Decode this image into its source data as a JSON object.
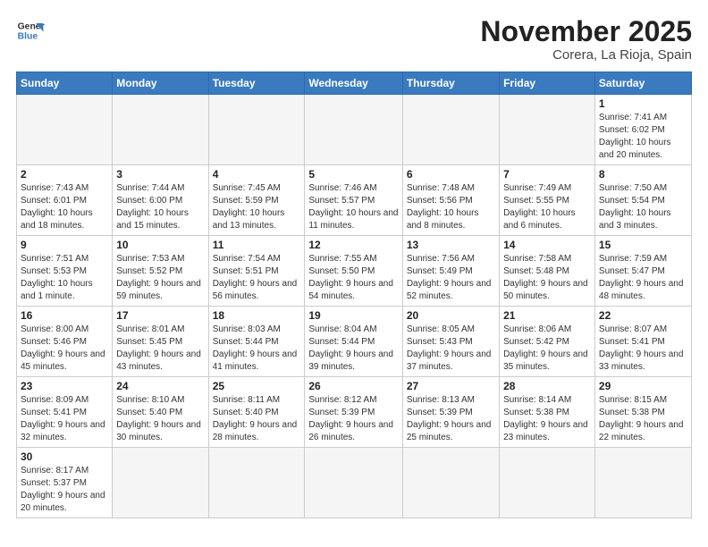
{
  "logo": {
    "general": "General",
    "blue": "Blue"
  },
  "header": {
    "month": "November 2025",
    "location": "Corera, La Rioja, Spain"
  },
  "weekdays": [
    "Sunday",
    "Monday",
    "Tuesday",
    "Wednesday",
    "Thursday",
    "Friday",
    "Saturday"
  ],
  "weeks": [
    [
      {
        "day": "",
        "info": ""
      },
      {
        "day": "",
        "info": ""
      },
      {
        "day": "",
        "info": ""
      },
      {
        "day": "",
        "info": ""
      },
      {
        "day": "",
        "info": ""
      },
      {
        "day": "",
        "info": ""
      },
      {
        "day": "1",
        "info": "Sunrise: 7:41 AM\nSunset: 6:02 PM\nDaylight: 10 hours\nand 20 minutes."
      }
    ],
    [
      {
        "day": "2",
        "info": "Sunrise: 7:43 AM\nSunset: 6:01 PM\nDaylight: 10 hours\nand 18 minutes."
      },
      {
        "day": "3",
        "info": "Sunrise: 7:44 AM\nSunset: 6:00 PM\nDaylight: 10 hours\nand 15 minutes."
      },
      {
        "day": "4",
        "info": "Sunrise: 7:45 AM\nSunset: 5:59 PM\nDaylight: 10 hours\nand 13 minutes."
      },
      {
        "day": "5",
        "info": "Sunrise: 7:46 AM\nSunset: 5:57 PM\nDaylight: 10 hours\nand 11 minutes."
      },
      {
        "day": "6",
        "info": "Sunrise: 7:48 AM\nSunset: 5:56 PM\nDaylight: 10 hours\nand 8 minutes."
      },
      {
        "day": "7",
        "info": "Sunrise: 7:49 AM\nSunset: 5:55 PM\nDaylight: 10 hours\nand 6 minutes."
      },
      {
        "day": "8",
        "info": "Sunrise: 7:50 AM\nSunset: 5:54 PM\nDaylight: 10 hours\nand 3 minutes."
      }
    ],
    [
      {
        "day": "9",
        "info": "Sunrise: 7:51 AM\nSunset: 5:53 PM\nDaylight: 10 hours\nand 1 minute."
      },
      {
        "day": "10",
        "info": "Sunrise: 7:53 AM\nSunset: 5:52 PM\nDaylight: 9 hours\nand 59 minutes."
      },
      {
        "day": "11",
        "info": "Sunrise: 7:54 AM\nSunset: 5:51 PM\nDaylight: 9 hours\nand 56 minutes."
      },
      {
        "day": "12",
        "info": "Sunrise: 7:55 AM\nSunset: 5:50 PM\nDaylight: 9 hours\nand 54 minutes."
      },
      {
        "day": "13",
        "info": "Sunrise: 7:56 AM\nSunset: 5:49 PM\nDaylight: 9 hours\nand 52 minutes."
      },
      {
        "day": "14",
        "info": "Sunrise: 7:58 AM\nSunset: 5:48 PM\nDaylight: 9 hours\nand 50 minutes."
      },
      {
        "day": "15",
        "info": "Sunrise: 7:59 AM\nSunset: 5:47 PM\nDaylight: 9 hours\nand 48 minutes."
      }
    ],
    [
      {
        "day": "16",
        "info": "Sunrise: 8:00 AM\nSunset: 5:46 PM\nDaylight: 9 hours\nand 45 minutes."
      },
      {
        "day": "17",
        "info": "Sunrise: 8:01 AM\nSunset: 5:45 PM\nDaylight: 9 hours\nand 43 minutes."
      },
      {
        "day": "18",
        "info": "Sunrise: 8:03 AM\nSunset: 5:44 PM\nDaylight: 9 hours\nand 41 minutes."
      },
      {
        "day": "19",
        "info": "Sunrise: 8:04 AM\nSunset: 5:44 PM\nDaylight: 9 hours\nand 39 minutes."
      },
      {
        "day": "20",
        "info": "Sunrise: 8:05 AM\nSunset: 5:43 PM\nDaylight: 9 hours\nand 37 minutes."
      },
      {
        "day": "21",
        "info": "Sunrise: 8:06 AM\nSunset: 5:42 PM\nDaylight: 9 hours\nand 35 minutes."
      },
      {
        "day": "22",
        "info": "Sunrise: 8:07 AM\nSunset: 5:41 PM\nDaylight: 9 hours\nand 33 minutes."
      }
    ],
    [
      {
        "day": "23",
        "info": "Sunrise: 8:09 AM\nSunset: 5:41 PM\nDaylight: 9 hours\nand 32 minutes."
      },
      {
        "day": "24",
        "info": "Sunrise: 8:10 AM\nSunset: 5:40 PM\nDaylight: 9 hours\nand 30 minutes."
      },
      {
        "day": "25",
        "info": "Sunrise: 8:11 AM\nSunset: 5:40 PM\nDaylight: 9 hours\nand 28 minutes."
      },
      {
        "day": "26",
        "info": "Sunrise: 8:12 AM\nSunset: 5:39 PM\nDaylight: 9 hours\nand 26 minutes."
      },
      {
        "day": "27",
        "info": "Sunrise: 8:13 AM\nSunset: 5:39 PM\nDaylight: 9 hours\nand 25 minutes."
      },
      {
        "day": "28",
        "info": "Sunrise: 8:14 AM\nSunset: 5:38 PM\nDaylight: 9 hours\nand 23 minutes."
      },
      {
        "day": "29",
        "info": "Sunrise: 8:15 AM\nSunset: 5:38 PM\nDaylight: 9 hours\nand 22 minutes."
      }
    ],
    [
      {
        "day": "30",
        "info": "Sunrise: 8:17 AM\nSunset: 5:37 PM\nDaylight: 9 hours\nand 20 minutes."
      },
      {
        "day": "",
        "info": ""
      },
      {
        "day": "",
        "info": ""
      },
      {
        "day": "",
        "info": ""
      },
      {
        "day": "",
        "info": ""
      },
      {
        "day": "",
        "info": ""
      },
      {
        "day": "",
        "info": ""
      }
    ]
  ]
}
